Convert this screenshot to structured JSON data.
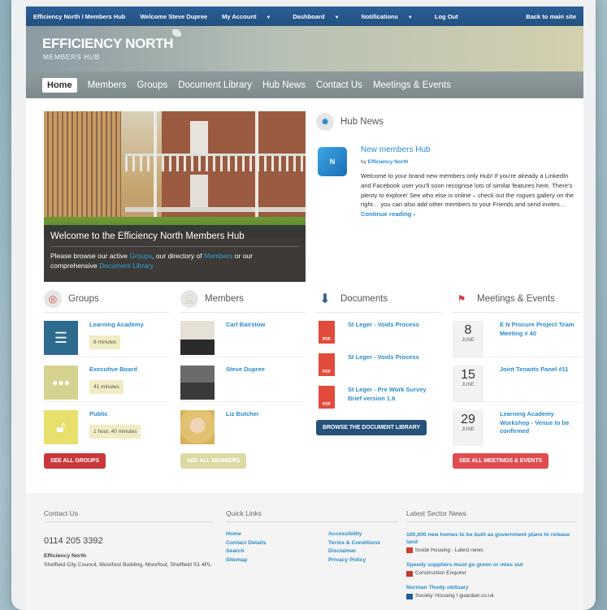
{
  "topbar": {
    "site": "Efficiency North I Members Hub",
    "welcome": "Welcome Steve Dupree",
    "account": "My Account",
    "dashboard": "Dashboard",
    "notifications": "Notifications",
    "logout": "Log Out",
    "back": "Back to main site"
  },
  "logo": {
    "main": "EFFICIENCY NORTH",
    "sub": "MEMBERS HUB"
  },
  "nav": [
    "Home",
    "Members",
    "Groups",
    "Document Library",
    "Hub News",
    "Contact Us",
    "Meetings & Events"
  ],
  "hero": {
    "title": "Welcome to the Efficiency North Members Hub",
    "text_1": "Please browse our active ",
    "link_groups": "Groups",
    "text_2": ", our directory of ",
    "link_members": "Members",
    "text_3": " or our comprehensive ",
    "link_library": "Document Library"
  },
  "hub_news": {
    "heading": "Hub News",
    "thumb": "N",
    "title": "New members Hub",
    "by_prefix": "by ",
    "author": "Efficiency North",
    "body": "Welcome to your brand new members only Hub! If you're already a LinkedIn and Facebook user you'll soon recognise lots of similar features here. There's plenty to explore! See who else is online – check out the rogues gallery on the right… you can also add other members to your Friends and send invites… ",
    "more": "Continue reading ›"
  },
  "groups": {
    "heading": "Groups",
    "items": [
      {
        "name": "Learning Academy",
        "time": "6 minutes",
        "color": "#2e6b8f"
      },
      {
        "name": "Executive Board",
        "time": "41 minutes",
        "color": "#d6d28f"
      },
      {
        "name": "Public",
        "time": "1 hour, 40 minutes",
        "color": "#e7e06c"
      }
    ],
    "button": "See all groups"
  },
  "members": {
    "heading": "Members",
    "items": [
      "Carl Bairstow",
      "Steve Dupree",
      "Liz Butcher"
    ],
    "button": "See all members"
  },
  "documents": {
    "heading": "Documents",
    "items": [
      "St Leger - Voids Process",
      "St Leger - Voids Process",
      "St Leger - Pre Work Survey Brief version 1.6"
    ],
    "pdf_label": "PDF",
    "button": "Browse the document library"
  },
  "events": {
    "heading": "Meetings & Events",
    "items": [
      {
        "day": "8",
        "month": "JUNE",
        "title": "E N Procure Project Team Meeting # 40"
      },
      {
        "day": "15",
        "month": "JUNE",
        "title": "Joint Tenants Panel #11"
      },
      {
        "day": "29",
        "month": "JUNE",
        "title": "Learning Academy Workshop - Venue to be confirmed"
      }
    ],
    "button": "See all meetings & events"
  },
  "footer": {
    "contact_heading": "Contact Us",
    "phone": "0114 205 3392",
    "org": "Efficiency North",
    "address": "Sheffield City Council, Moorfoot Building, Moorfoot, Sheffield S1 4PL",
    "links_heading": "Quick Links",
    "links_col1": [
      "Home",
      "Contact Details",
      "Search",
      "Sitemap"
    ],
    "links_col2": [
      "Accessibility",
      "Terms & Conditions",
      "Disclaimer",
      "Privacy Policy"
    ],
    "news_heading": "Latest Sector News",
    "news": [
      {
        "title": "100,000 new homes to be built as government plans to release land",
        "source": "Inside Housing - Latest news"
      },
      {
        "title": "Speedy suppliers must go green or miss out",
        "source": "Construction Enquirer"
      },
      {
        "title": "Norman Thody obituary",
        "source": "Society: Housing I guardian.co.uk"
      }
    ]
  }
}
